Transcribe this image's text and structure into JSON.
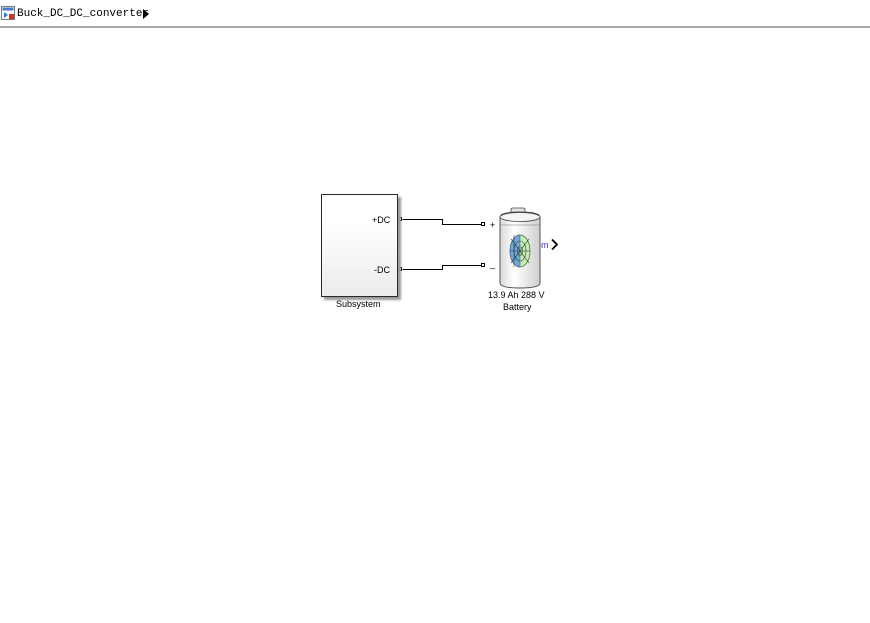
{
  "breadcrumb": {
    "model_name": "Buck_DC_DC_converter",
    "model_icon": "simulink-model-icon",
    "arrow_icon": "triangle-right-icon"
  },
  "diagram": {
    "subsystem": {
      "caption": "Subsystem",
      "ports": {
        "pos": "+DC",
        "neg": "-DC"
      }
    },
    "battery": {
      "rating": "13.9 Ah 288 V",
      "caption": "Battery",
      "plus_sign": "+",
      "minus_sign": "_",
      "measure_port": "m",
      "icon": "battery-icon"
    }
  },
  "colors": {
    "wire": "#000000",
    "measure_label": "#3333cc",
    "block_border": "#2a2a2a",
    "bar_border": "#a8a8a8"
  }
}
